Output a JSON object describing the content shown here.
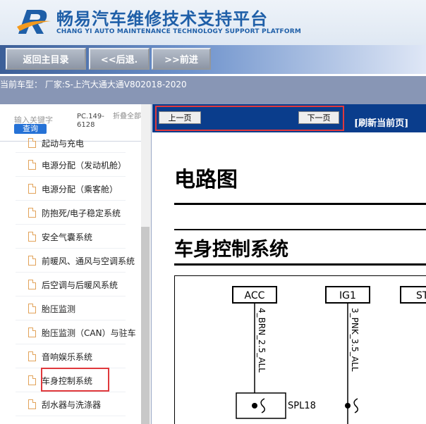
{
  "header": {
    "title": "畅易汽车维修技术支持平台",
    "subtitle": "CHANG YI AUTO MAINTENANCE TECHNOLOGY SUPPORT PLATFORM"
  },
  "toolbar": {
    "back_label": "返回主目录",
    "prev_label": "<<后退.",
    "next_label": ">>前进"
  },
  "current_vehicle": {
    "text": "当前车型： 厂家:S-上汽大通大通V802018-2020"
  },
  "sidebar": {
    "keyword_placeholder": "输入关键字",
    "search_label": "查询",
    "pc_code": "PC.149-6128",
    "collapse_label": "折叠全部",
    "items": [
      {
        "label": "起动与充电"
      },
      {
        "label": "电源分配（发动机舱）"
      },
      {
        "label": "电源分配（乘客舱）"
      },
      {
        "label": "防抱死/电子稳定系统"
      },
      {
        "label": "安全气囊系统"
      },
      {
        "label": "前暖风、通风与空调系统"
      },
      {
        "label": "后空调与后暖风系统"
      },
      {
        "label": "胎压监测"
      },
      {
        "label": "胎压监测（CAN）与驻车"
      },
      {
        "label": "音响娱乐系统"
      },
      {
        "label": "车身控制系统"
      },
      {
        "label": "刮水器与洗涤器"
      }
    ]
  },
  "content": {
    "prev_page": "上一页",
    "next_page": "下一页",
    "refresh_label": "[刷新当前页]",
    "heading": "电路图",
    "subheading": "车身控制系统",
    "diagram": {
      "terminal_1": "ACC",
      "terminal_2": "IG1",
      "terminal_3": "ST",
      "wire_1": "4_BRN_2.5_ALL",
      "wire_2": "3_PNK_3.5_ALL",
      "splice": "SPL18"
    }
  },
  "colors": {
    "brand_blue": "#1f5fa8",
    "pager_blue": "#0a3d8c",
    "highlight_red": "#e0383c",
    "search_blue": "#2672d6"
  }
}
